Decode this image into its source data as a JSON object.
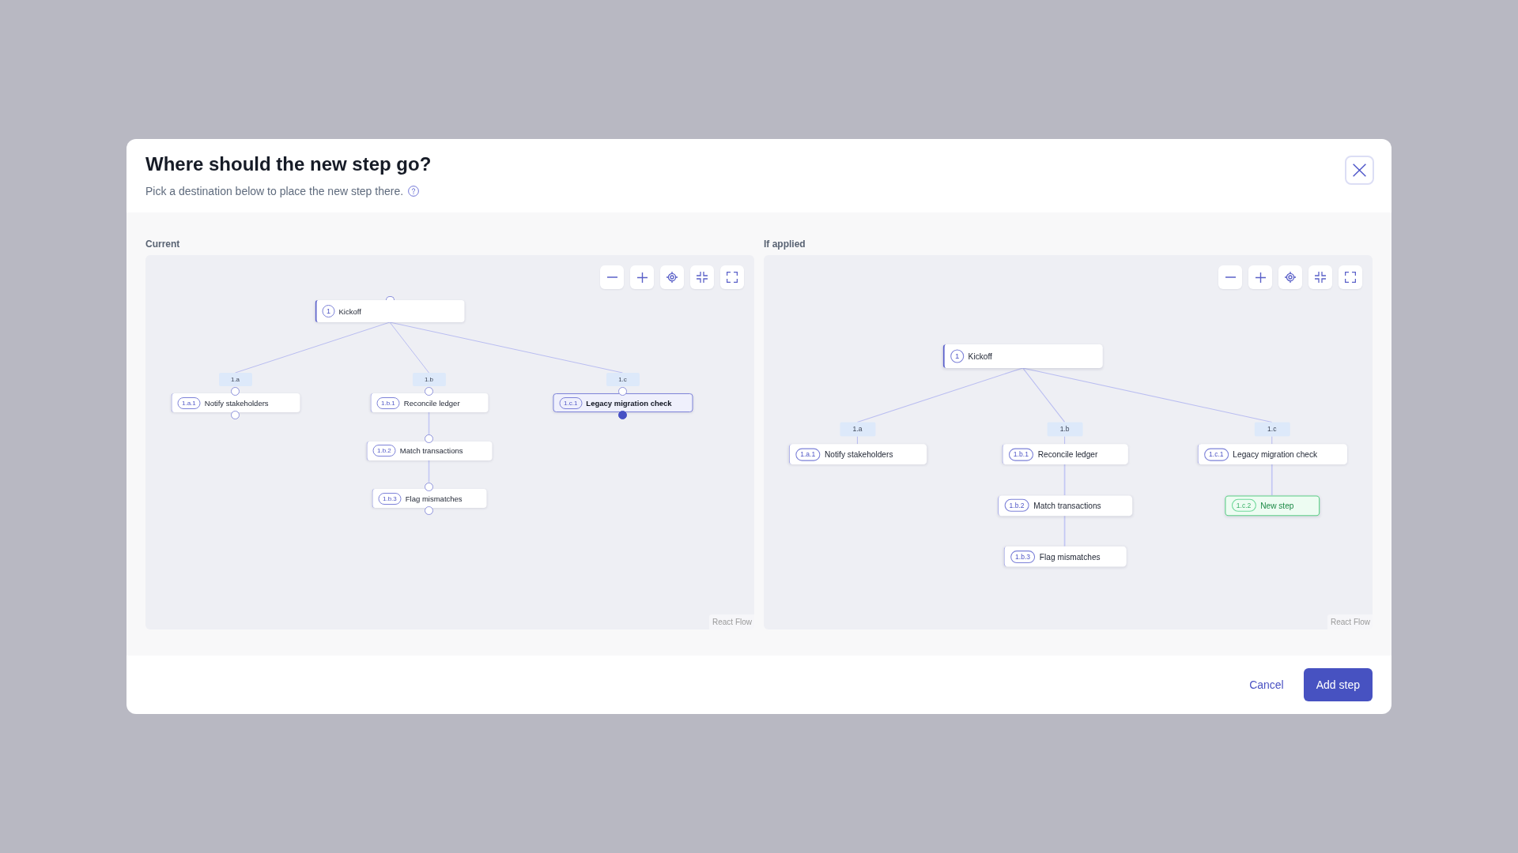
{
  "dialog": {
    "title": "Where should the new step go?",
    "subtitle": "Pick a destination below to place the new step there.",
    "panels": [
      {
        "label": "Current",
        "kind": "picker",
        "attribution": "React Flow",
        "tree": {
          "badge": "1",
          "title": "Kickoff",
          "children": [
            {
              "label": "1.a",
              "steps": [
                {
                  "badge": "1.a.1",
                  "title": "Notify stakeholders",
                  "kind": "step",
                  "selected": false
                }
              ]
            },
            {
              "label": "1.b",
              "steps": [
                {
                  "badge": "1.b.1",
                  "title": "Reconcile ledger",
                  "kind": "step",
                  "selected": false
                },
                {
                  "badge": "1.b.2",
                  "title": "Match transactions",
                  "kind": "step",
                  "selected": false
                },
                {
                  "badge": "1.b.3",
                  "title": "Flag mismatches",
                  "kind": "step",
                  "selected": false
                }
              ]
            },
            {
              "label": "1.c",
              "steps": [
                {
                  "badge": "1.c.1",
                  "title": "Legacy migration check",
                  "kind": "step",
                  "selected": true
                }
              ]
            }
          ]
        }
      },
      {
        "label": "If applied",
        "kind": "preview",
        "attribution": "React Flow",
        "tree": {
          "badge": "1",
          "title": "Kickoff",
          "children": [
            {
              "label": "1.a",
              "steps": [
                {
                  "badge": "1.a.1",
                  "title": "Notify stakeholders",
                  "kind": "step"
                }
              ]
            },
            {
              "label": "1.b",
              "steps": [
                {
                  "badge": "1.b.1",
                  "title": "Reconcile ledger",
                  "kind": "step"
                },
                {
                  "badge": "1.b.2",
                  "title": "Match transactions",
                  "kind": "step"
                },
                {
                  "badge": "1.b.3",
                  "title": "Flag mismatches",
                  "kind": "step"
                }
              ]
            },
            {
              "label": "1.c",
              "steps": [
                {
                  "badge": "1.c.1",
                  "title": "Legacy migration check",
                  "kind": "step"
                },
                {
                  "badge": "1.c.2",
                  "title": "New step",
                  "kind": "new"
                }
              ]
            }
          ]
        }
      }
    ],
    "buttons": [
      {
        "label": "Cancel",
        "kind": "link"
      },
      {
        "label": "Add step",
        "kind": "primary"
      }
    ]
  }
}
